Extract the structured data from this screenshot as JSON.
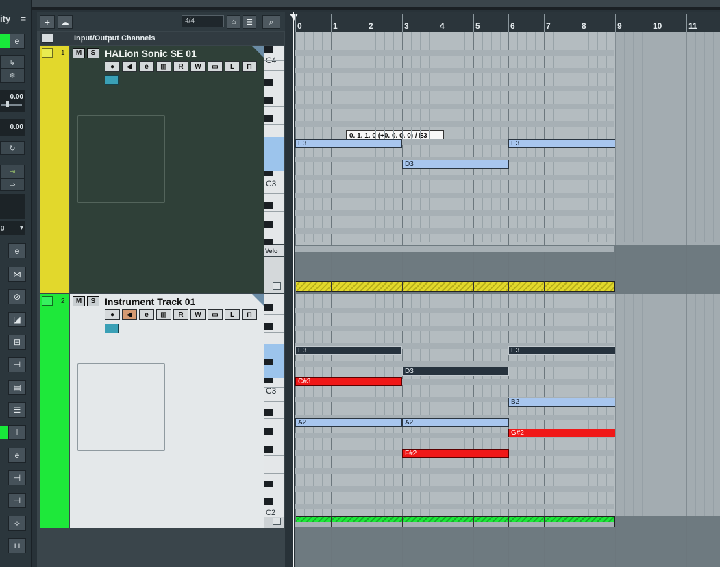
{
  "inspector": {
    "title": "ity",
    "menu_glyph": "=",
    "value_1": "0.00",
    "value_2": "0.00",
    "dropdown_label": "g",
    "icons": [
      "edit-icon",
      "routing-icon",
      "freeze-icon",
      "sync-icon",
      "split-icon",
      "gauge-icon",
      "mute-icon",
      "quantize-icon",
      "insert-icon",
      "notepad-icon",
      "equalizer-icon",
      "chord-icon",
      "send-icon",
      "fader-icon",
      "channel-icon",
      "meter-icon"
    ]
  },
  "toolbar": {
    "add_label": "+",
    "time_signature": "4/4"
  },
  "track_list": {
    "io_header": "Input/Output Channels",
    "tracks": [
      {
        "number": "1",
        "name": "HALion Sonic SE 01",
        "color": "#e2d82c",
        "body_color": "#2f4038",
        "name_color": "#f1f5f2"
      },
      {
        "number": "2",
        "name": "Instrument Track 01",
        "color": "#1ee83a",
        "body_color": "#e4e8ea",
        "name_color": "#111111"
      }
    ],
    "mute_label": "M",
    "solo_label": "S",
    "read_label": "R",
    "write_label": "W",
    "lane_label": "L"
  },
  "keyboard": {
    "top_labels": [
      "C4",
      "C3"
    ],
    "bottom_labels": [
      "C3",
      "C2"
    ],
    "velocity_label": "Velo"
  },
  "ruler": {
    "bars": [
      "0",
      "1",
      "2",
      "3",
      "4",
      "5",
      "6",
      "7",
      "8",
      "9",
      "10",
      "11"
    ]
  },
  "editor": {
    "tooltip": "0. 1. 1.  0 (+0. 0. 0.  0) / E3",
    "top_notes": [
      {
        "label": "E3",
        "start": 0,
        "end": 3,
        "row": "E3",
        "style": "blue"
      },
      {
        "label": "E3",
        "start": 6,
        "end": 9,
        "row": "E3",
        "style": "blue"
      },
      {
        "label": "D3",
        "start": 3,
        "end": 6,
        "row": "D3",
        "style": "blue"
      }
    ],
    "bottom_notes": [
      {
        "label": "E3",
        "start": 0,
        "end": 3,
        "row": "E3",
        "style": "dark"
      },
      {
        "label": "E3",
        "start": 6,
        "end": 9,
        "row": "E3",
        "style": "dark"
      },
      {
        "label": "D3",
        "start": 3,
        "end": 6,
        "row": "D3",
        "style": "dark"
      },
      {
        "label": "C#3",
        "start": 0,
        "end": 3,
        "row": "C#3",
        "style": "red"
      },
      {
        "label": "B2",
        "start": 6,
        "end": 9,
        "row": "B2",
        "style": "blue"
      },
      {
        "label": "A2",
        "start": 0,
        "end": 3,
        "row": "A2",
        "style": "blue"
      },
      {
        "label": "A2",
        "start": 3,
        "end": 6,
        "row": "A2",
        "style": "blue"
      },
      {
        "label": "G#2",
        "start": 6,
        "end": 9,
        "row": "G#2",
        "style": "red"
      },
      {
        "label": "F#2",
        "start": 3,
        "end": 6,
        "row": "F#2",
        "style": "red"
      }
    ],
    "part_colors": [
      "#e2d82c",
      "#1ee83a"
    ],
    "part_length_bars": 9
  }
}
